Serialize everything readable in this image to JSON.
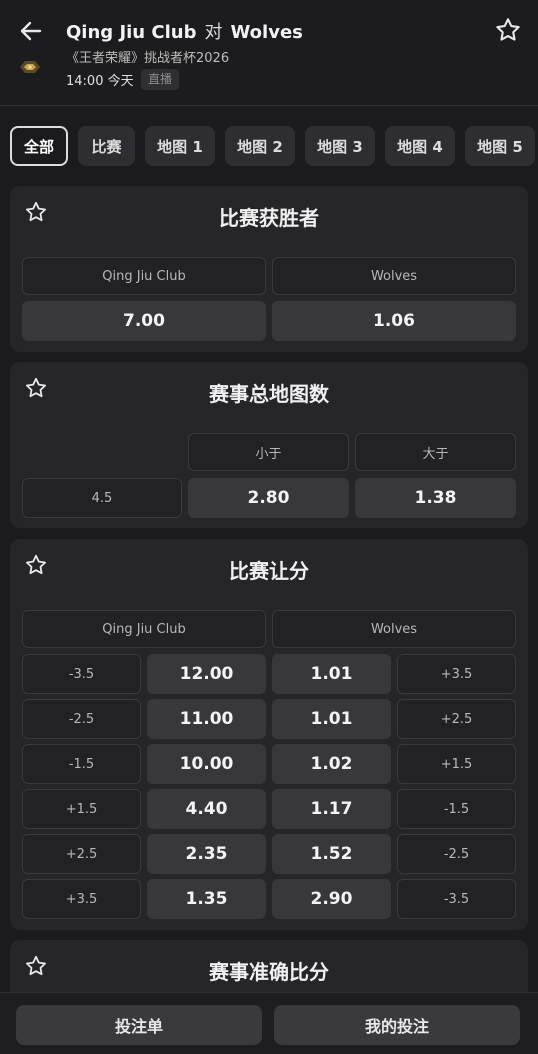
{
  "header": {
    "team_home": "Qing Jiu Club",
    "vs": "对",
    "team_away": "Wolves",
    "league": "《王者荣耀》挑战者杯2026",
    "time": "14:00 今天",
    "status": "直播"
  },
  "tabs": [
    "全部",
    "比赛",
    "地图 1",
    "地图 2",
    "地图 3",
    "地图 4",
    "地图 5"
  ],
  "match_winner": {
    "title": "比赛获胜者",
    "home_label": "Qing Jiu Club",
    "away_label": "Wolves",
    "home_odds": "7.00",
    "away_odds": "1.06"
  },
  "total_maps": {
    "title": "赛事总地图数",
    "under_label": "小于",
    "over_label": "大于",
    "line": "4.5",
    "under_odds": "2.80",
    "over_odds": "1.38"
  },
  "handicap": {
    "title": "比赛让分",
    "home_label": "Qing Jiu Club",
    "away_label": "Wolves",
    "rows": [
      {
        "home_line": "-3.5",
        "home_odds": "12.00",
        "away_odds": "1.01",
        "away_line": "+3.5"
      },
      {
        "home_line": "-2.5",
        "home_odds": "11.00",
        "away_odds": "1.01",
        "away_line": "+2.5"
      },
      {
        "home_line": "-1.5",
        "home_odds": "10.00",
        "away_odds": "1.02",
        "away_line": "+1.5"
      },
      {
        "home_line": "+1.5",
        "home_odds": "4.40",
        "away_odds": "1.17",
        "away_line": "-1.5"
      },
      {
        "home_line": "+2.5",
        "home_odds": "2.35",
        "away_odds": "1.52",
        "away_line": "-2.5"
      },
      {
        "home_line": "+3.5",
        "home_odds": "1.35",
        "away_odds": "2.90",
        "away_line": "-3.5"
      }
    ]
  },
  "correct_score": {
    "title": "赛事准确比分"
  },
  "footer": {
    "betslip": "投注单",
    "my_bets": "我的投注"
  },
  "icons": {
    "back": "arrow-left-icon",
    "favorite": "star-outline-icon",
    "league_logo": "league-logo-icon"
  }
}
